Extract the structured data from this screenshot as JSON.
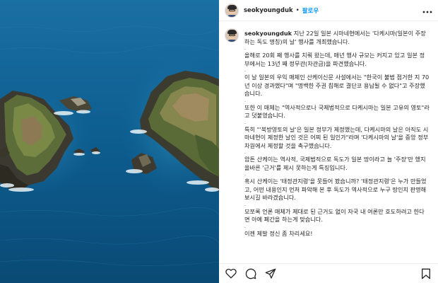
{
  "post": {
    "username": "seokyoungduk",
    "follow_label": "팔로우",
    "separator": "•",
    "more_icon": "more-horizontal-icon"
  },
  "caption": {
    "username": "seokyoungduk",
    "paragraphs": [
      "지난 22일 일본 시마네현에서는 '다케시마(일본이 주장하는 독도 명칭)의 날' 행사를 개최했습니다.",
      "올해로 20회 째 행사를 치뤄 왔는데, 매년 행사 규모는 커지고 있고 일본 정부에서는 13년 째 정무관(차관급)을 파견했습니다.",
      "이 날 일본의 우익 매체인 산케이신문 사설에서는 \"한국이 불법 점거한 지 70년 이상 경과했다\"며 \"명백한 주권 침해로 결단코 용납될 수 없다\"고 주장했습니다.",
      "또한 이 매체는 \"역사적으로나 국제법적으로 다케시마는 일본 고유의 영토\"라고 덧붙였습니다.",
      "특히 \"'북방영토의 날'은 일본 정부가 제정했는데, 다케시마의 날은 아직도 시마네현이 제정한 날인 것은 어찌 된 일인가\"라며 '다케시마의 날'을 중앙 정부 차원에서 제정할 것을 촉구했습니다.",
      "암튼 산케이는 역사적, 국제법적으로 독도가 일본 땅이라고 늘 '주장'만 했지 올바른 '근거'를 제시 못하는게 특징입니다.",
      "혹시 산케이는 '태정관지령'을 못들어 봤습니까? '태정관지령'은 누가 만들었고, 어떤 내용인지 먼저 파악해 본 후 독도가 역사적으로 누구 땅인지 판명해 보시길 바라겠습니다.",
      "모쪼록 언론 매체가 제대로 된 근거도 없이 자국 내 여론만 호도하려고 한다면 아예 폐간을 하는게 맞습니다.",
      "이젠 제발 정신 좀 차리세요!"
    ],
    "gap_marker": "."
  },
  "actions": {
    "like_icon": "heart-icon",
    "comment_icon": "comment-icon",
    "share_icon": "send-icon",
    "save_icon": "bookmark-icon"
  },
  "colors": {
    "link_blue": "#0095f6",
    "text": "#262626",
    "sea": "#0f5a86"
  }
}
